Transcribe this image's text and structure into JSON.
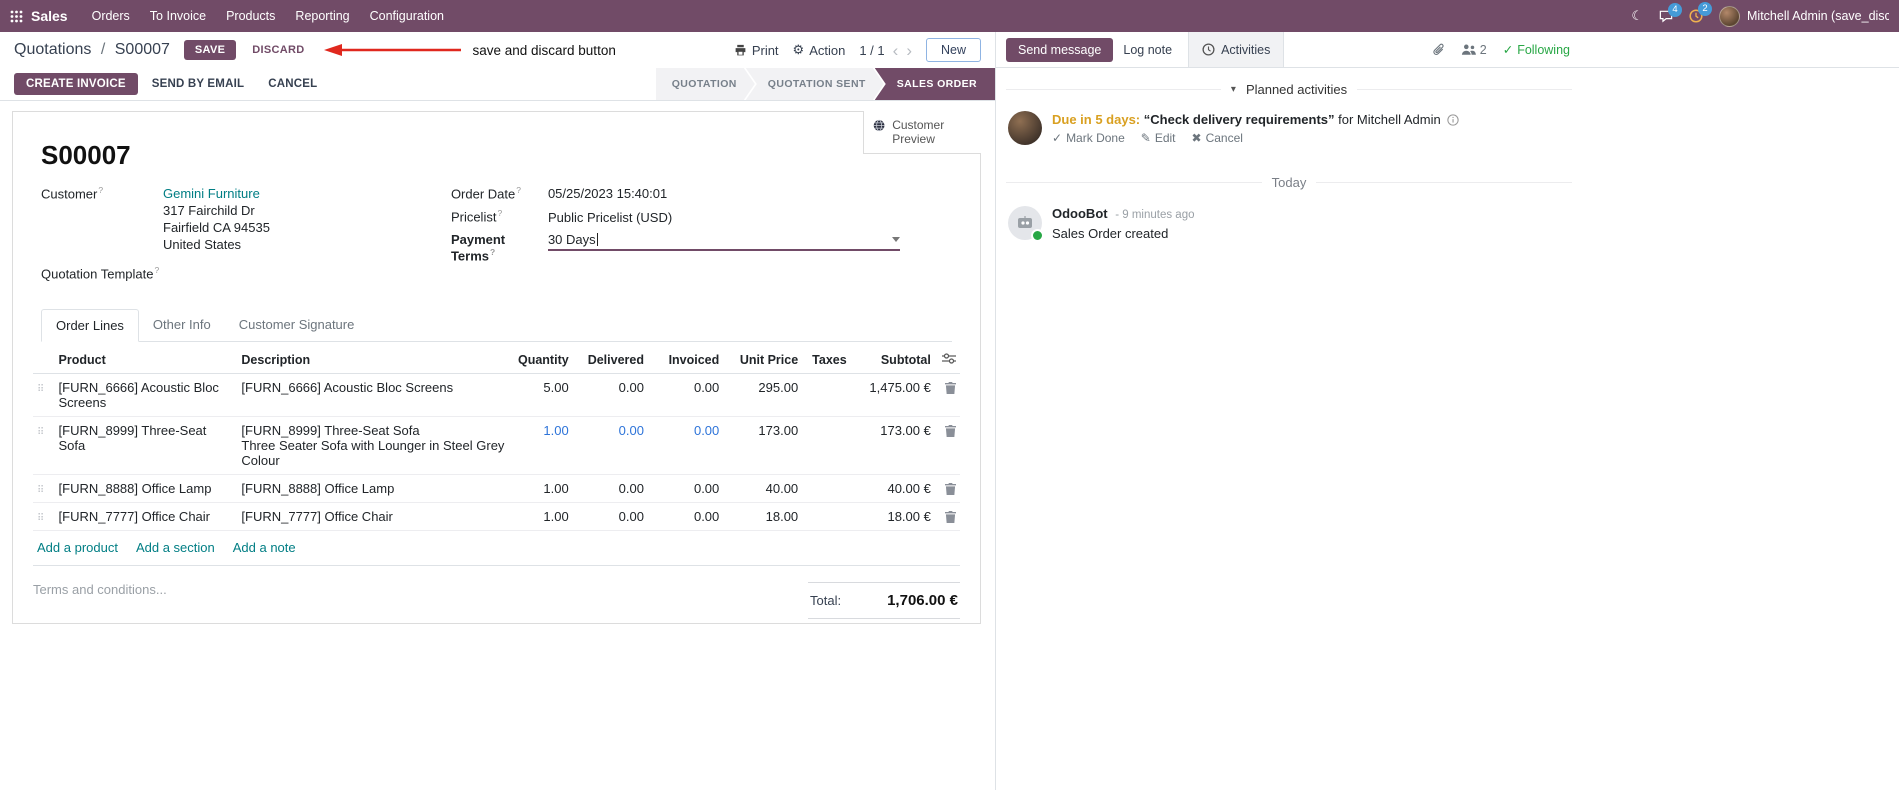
{
  "colors": {
    "accent": "#714B67",
    "link_teal": "#017E84",
    "value_blue": "#2e74d9",
    "annotation_red": "#e0281e",
    "due_orange": "#d9a021",
    "following_green": "#28a745"
  },
  "navbar": {
    "app_name": "Sales",
    "menus": [
      "Orders",
      "To Invoice",
      "Products",
      "Reporting",
      "Configuration"
    ],
    "messages_badge": "4",
    "activities_badge": "2",
    "user_name": "Mitchell Admin (save_discar"
  },
  "control": {
    "breadcrumb_parent": "Quotations",
    "breadcrumb_sep": "/",
    "breadcrumb_current": "S00007",
    "save": "SAVE",
    "discard": "DISCARD",
    "annotation": "save and discard button",
    "print": "Print",
    "action": "Action",
    "pager": "1 / 1",
    "prev": "‹",
    "next": "›",
    "new": "New"
  },
  "statusbar": {
    "create_invoice": "CREATE INVOICE",
    "send_by_email": "SEND BY EMAIL",
    "cancel": "CANCEL",
    "steps": [
      "QUOTATION",
      "QUOTATION SENT",
      "SALES ORDER"
    ],
    "active_step": "SALES ORDER"
  },
  "sheet": {
    "customer_preview": "Customer Preview",
    "title": "S00007",
    "hint": "?",
    "customer": {
      "label": "Customer",
      "name": "Gemini Furniture",
      "address_lines": [
        "317 Fairchild Dr",
        "Fairfield CA 94535",
        "United States"
      ]
    },
    "quotation_template_label": "Quotation Template",
    "order_date": {
      "label": "Order Date",
      "value": "05/25/2023 15:40:01"
    },
    "pricelist": {
      "label": "Pricelist",
      "value": "Public Pricelist (USD)"
    },
    "payment_terms": {
      "label": "Payment Terms",
      "value": "30 Days"
    }
  },
  "tabs": {
    "order_lines": "Order Lines",
    "other_info": "Other Info",
    "customer_signature": "Customer Signature"
  },
  "table": {
    "headers": {
      "product": "Product",
      "description": "Description",
      "quantity": "Quantity",
      "delivered": "Delivered",
      "invoiced": "Invoiced",
      "unit_price": "Unit Price",
      "taxes": "Taxes",
      "subtotal": "Subtotal"
    },
    "rows": [
      {
        "product": "[FURN_6666] Acoustic Bloc Screens",
        "desc": "[FURN_6666] Acoustic Bloc Screens",
        "desc2": "",
        "qty": "5.00",
        "delivered": "0.00",
        "invoiced": "0.00",
        "price": "295.00",
        "subtotal": "1,475.00 €"
      },
      {
        "product": "[FURN_8999] Three-Seat Sofa",
        "desc": "[FURN_8999] Three-Seat Sofa",
        "desc2": "Three Seater Sofa with Lounger in Steel Grey Colour",
        "qty": "1.00",
        "delivered": "0.00",
        "invoiced": "0.00",
        "price": "173.00",
        "subtotal": "173.00 €"
      },
      {
        "product": "[FURN_8888] Office Lamp",
        "desc": "[FURN_8888] Office Lamp",
        "desc2": "",
        "qty": "1.00",
        "delivered": "0.00",
        "invoiced": "0.00",
        "price": "40.00",
        "subtotal": "40.00 €"
      },
      {
        "product": "[FURN_7777] Office Chair",
        "desc": "[FURN_7777] Office Chair",
        "desc2": "",
        "qty": "1.00",
        "delivered": "0.00",
        "invoiced": "0.00",
        "price": "18.00",
        "subtotal": "18.00 €"
      }
    ],
    "add_product": "Add a product",
    "add_section": "Add a section",
    "add_note": "Add a note",
    "terms_placeholder": "Terms and conditions...",
    "total_label": "Total:",
    "total_value": "1,706.00 €"
  },
  "chatter": {
    "send_message": "Send message",
    "log_note": "Log note",
    "activities_tab": "Activities",
    "followers_count": "2",
    "following": "Following",
    "planned_header": "Planned activities",
    "activity": {
      "due": "Due in 5 days:",
      "summary": "“Check delivery requirements”",
      "assignee": "for Mitchell Admin",
      "mark_done": "Mark Done",
      "edit": "Edit",
      "cancel": "Cancel"
    },
    "today": "Today",
    "message": {
      "author": "OdooBot",
      "time": "- 9 minutes ago",
      "body": "Sales Order created"
    }
  }
}
